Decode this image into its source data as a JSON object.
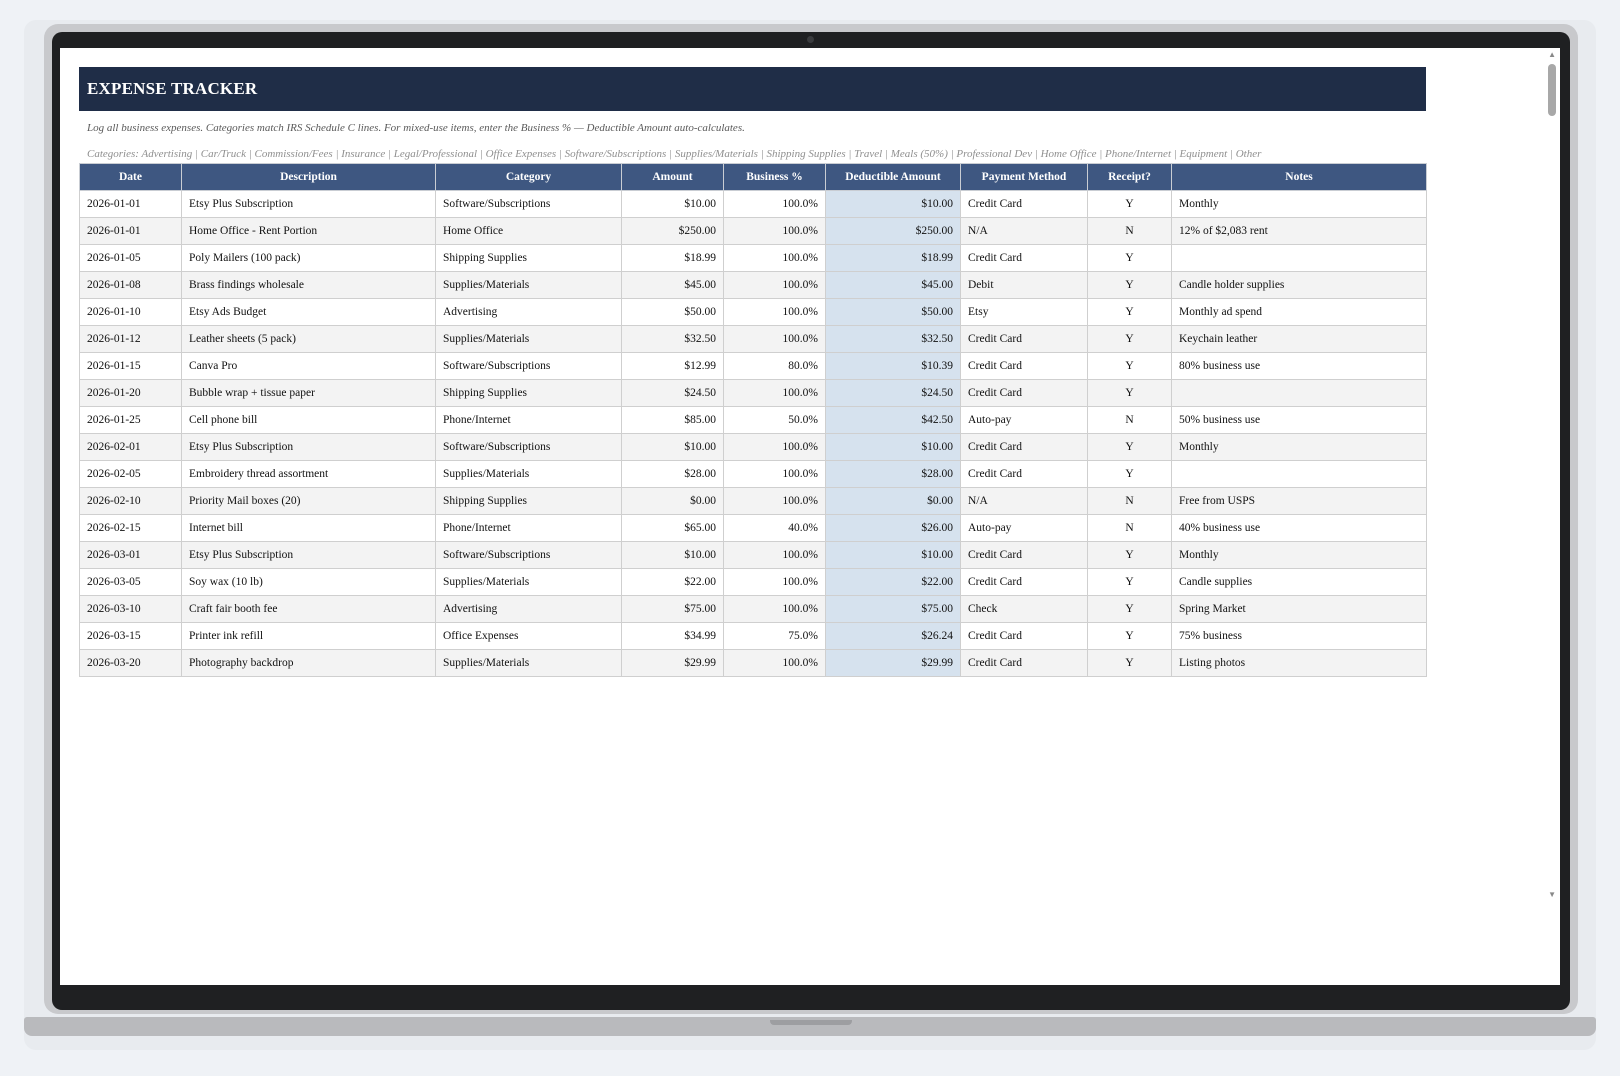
{
  "sheet": {
    "title": "EXPENSE TRACKER",
    "subtitle": "Log all business expenses. Categories match IRS Schedule C lines. For mixed-use items, enter the Business % — Deductible Amount auto-calculates.",
    "categories_line": "Categories: Advertising | Car/Truck | Commission/Fees | Insurance | Legal/Professional | Office Expenses | Software/Subscriptions | Supplies/Materials | Shipping Supplies | Travel | Meals (50%) | Professional Dev | Home Office | Phone/Internet | Equipment | Other"
  },
  "columns": [
    "Date",
    "Description",
    "Category",
    "Amount",
    "Business %",
    "Deductible Amount",
    "Payment Method",
    "Receipt?",
    "Notes"
  ],
  "rows": [
    [
      "2026-01-01",
      "Etsy Plus Subscription",
      "Software/Subscriptions",
      "$10.00",
      "100.0%",
      "$10.00",
      "Credit Card",
      "Y",
      "Monthly"
    ],
    [
      "2026-01-01",
      "Home Office - Rent Portion",
      "Home Office",
      "$250.00",
      "100.0%",
      "$250.00",
      "N/A",
      "N",
      "12% of $2,083 rent"
    ],
    [
      "2026-01-05",
      "Poly Mailers (100 pack)",
      "Shipping Supplies",
      "$18.99",
      "100.0%",
      "$18.99",
      "Credit Card",
      "Y",
      ""
    ],
    [
      "2026-01-08",
      "Brass findings wholesale",
      "Supplies/Materials",
      "$45.00",
      "100.0%",
      "$45.00",
      "Debit",
      "Y",
      "Candle holder supplies"
    ],
    [
      "2026-01-10",
      "Etsy Ads Budget",
      "Advertising",
      "$50.00",
      "100.0%",
      "$50.00",
      "Etsy",
      "Y",
      "Monthly ad spend"
    ],
    [
      "2026-01-12",
      "Leather sheets (5 pack)",
      "Supplies/Materials",
      "$32.50",
      "100.0%",
      "$32.50",
      "Credit Card",
      "Y",
      "Keychain leather"
    ],
    [
      "2026-01-15",
      "Canva Pro",
      "Software/Subscriptions",
      "$12.99",
      "80.0%",
      "$10.39",
      "Credit Card",
      "Y",
      "80% business use"
    ],
    [
      "2026-01-20",
      "Bubble wrap + tissue paper",
      "Shipping Supplies",
      "$24.50",
      "100.0%",
      "$24.50",
      "Credit Card",
      "Y",
      ""
    ],
    [
      "2026-01-25",
      "Cell phone bill",
      "Phone/Internet",
      "$85.00",
      "50.0%",
      "$42.50",
      "Auto-pay",
      "N",
      "50% business use"
    ],
    [
      "2026-02-01",
      "Etsy Plus Subscription",
      "Software/Subscriptions",
      "$10.00",
      "100.0%",
      "$10.00",
      "Credit Card",
      "Y",
      "Monthly"
    ],
    [
      "2026-02-05",
      "Embroidery thread assortment",
      "Supplies/Materials",
      "$28.00",
      "100.0%",
      "$28.00",
      "Credit Card",
      "Y",
      ""
    ],
    [
      "2026-02-10",
      "Priority Mail boxes (20)",
      "Shipping Supplies",
      "$0.00",
      "100.0%",
      "$0.00",
      "N/A",
      "N",
      "Free from USPS"
    ],
    [
      "2026-02-15",
      "Internet bill",
      "Phone/Internet",
      "$65.00",
      "40.0%",
      "$26.00",
      "Auto-pay",
      "N",
      "40% business use"
    ],
    [
      "2026-03-01",
      "Etsy Plus Subscription",
      "Software/Subscriptions",
      "$10.00",
      "100.0%",
      "$10.00",
      "Credit Card",
      "Y",
      "Monthly"
    ],
    [
      "2026-03-05",
      "Soy wax (10 lb)",
      "Supplies/Materials",
      "$22.00",
      "100.0%",
      "$22.00",
      "Credit Card",
      "Y",
      "Candle supplies"
    ],
    [
      "2026-03-10",
      "Craft fair booth fee",
      "Advertising",
      "$75.00",
      "100.0%",
      "$75.00",
      "Check",
      "Y",
      "Spring Market"
    ],
    [
      "2026-03-15",
      "Printer ink refill",
      "Office Expenses",
      "$34.99",
      "75.0%",
      "$26.24",
      "Credit Card",
      "Y",
      "75% business"
    ],
    [
      "2026-03-20",
      "Photography backdrop",
      "Supplies/Materials",
      "$29.99",
      "100.0%",
      "$29.99",
      "Credit Card",
      "Y",
      "Listing photos"
    ]
  ],
  "colors": {
    "title_bg": "#1f2d47",
    "header_bg": "#3e5781",
    "deductible_bg": "#d6e2ee"
  }
}
